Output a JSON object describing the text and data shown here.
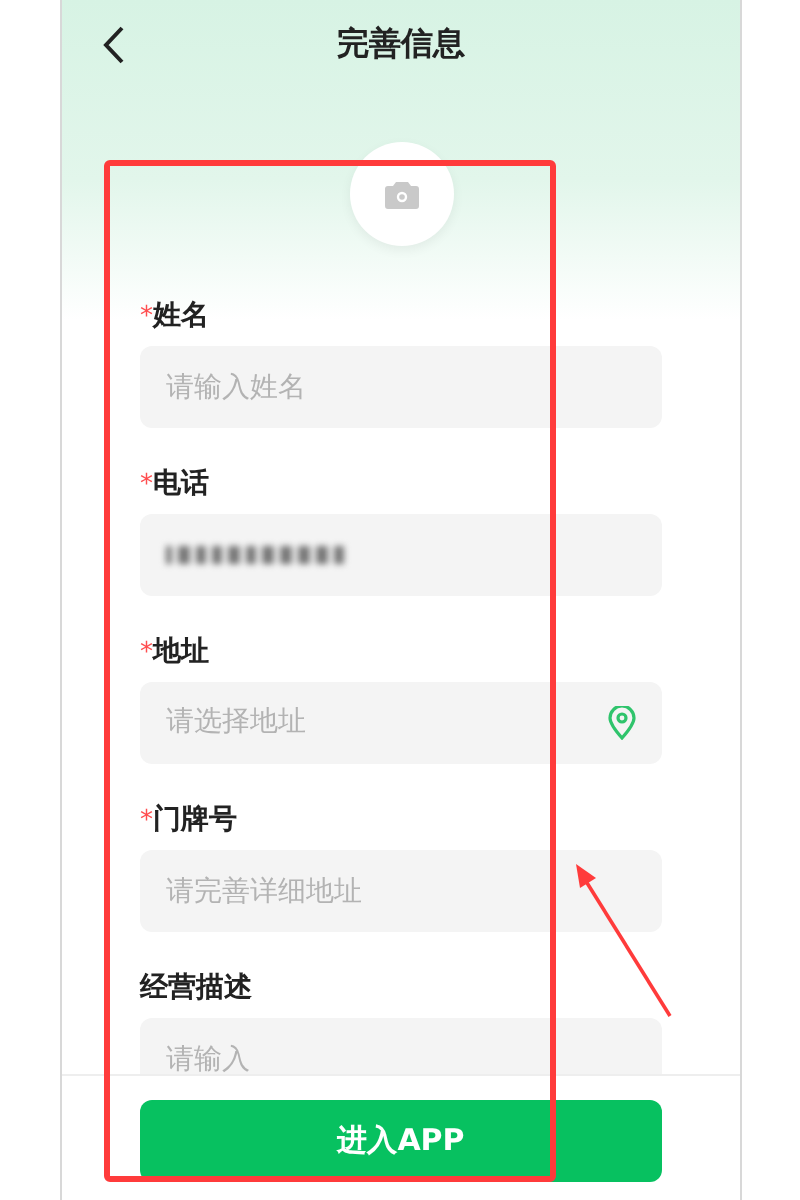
{
  "header": {
    "title": "完善信息"
  },
  "fields": [
    {
      "kind": "text",
      "required_mark": "*",
      "label": "姓名",
      "placeholder": "请输入姓名"
    },
    {
      "kind": "blurred",
      "required_mark": "*",
      "label": "电话"
    },
    {
      "kind": "location",
      "required_mark": "*",
      "label": "地址",
      "placeholder": "请选择地址"
    },
    {
      "kind": "text",
      "required_mark": "*",
      "label": "门牌号",
      "placeholder": "请完善详细地址"
    },
    {
      "kind": "text",
      "label": "经营描述",
      "placeholder": "请输入"
    }
  ],
  "submit_button": "进入APP"
}
